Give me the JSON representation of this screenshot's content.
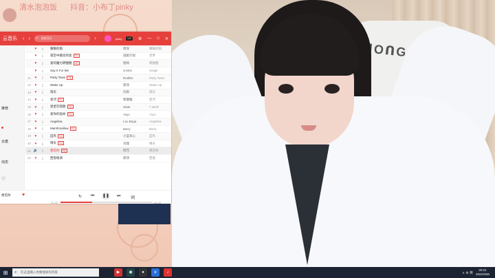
{
  "overlay": {
    "title_a": "清水泡泡饭",
    "title_b": "抖音：小布丁pinky"
  },
  "player": {
    "brand": "云音乐",
    "search_placeholder": "搜索音乐",
    "user": "pinky",
    "vip": "VIP",
    "sidebar": [
      "推荐",
      "动态",
      "云盘",
      "收藏"
    ],
    "songs": [
      {
        "idx": "",
        "title": "暖暖的抱",
        "tag": "",
        "artist": "周深",
        "album": "暖暖的抱"
      },
      {
        "idx": "",
        "title": "夜空中最亮的星",
        "tag": "SQ",
        "artist": "逃跑计划",
        "album": "世界"
      },
      {
        "idx": "",
        "title": "爱的魔力转圈圈",
        "tag": "SQ",
        "artist": "程响",
        "album": "转圈圈"
      },
      {
        "idx": "",
        "title": "Say It For Me",
        "tag": "",
        "artist": "S.Mon",
        "album": "Single"
      },
      {
        "idx": "11",
        "title": "Party Town",
        "tag": "SQ",
        "artist": "RedMo",
        "album": "Party Town"
      },
      {
        "idx": "12",
        "title": "Wake Up",
        "tag": "",
        "artist": "郭顶",
        "album": "Wake Up"
      },
      {
        "idx": "13",
        "title": "雨天",
        "tag": "",
        "artist": "刘恩",
        "album": "雨天"
      },
      {
        "idx": "14",
        "title": "星河",
        "tag": "SQ",
        "artist": "蔡健雅",
        "album": "星河"
      },
      {
        "idx": "15",
        "title": "星星在唱歌",
        "tag": "SQ",
        "artist": "State",
        "album": "7 twelF"
      },
      {
        "idx": "16",
        "title": "爱你的宿命",
        "tag": "SQ",
        "artist": "Yoyo",
        "album": "Yoyo"
      },
      {
        "idx": "17",
        "title": "Angelina",
        "tag": "",
        "artist": "Lou Bega",
        "album": "Angelina"
      },
      {
        "idx": "18",
        "title": "Marshmallow",
        "tag": "SQ",
        "artist": "Barry",
        "album": "Barry"
      },
      {
        "idx": "19",
        "title": "囚鸟",
        "tag": "SQ",
        "artist": "小蓝背心",
        "album": "囚鸟"
      },
      {
        "idx": "20",
        "title": "晴天",
        "tag": "SQ",
        "artist": "刘瑞",
        "album": "晴天"
      },
      {
        "idx": "21",
        "title": "想见你",
        "tag": "SQ",
        "artist": "阿冗",
        "album": "想见你"
      },
      {
        "idx": "22",
        "title": "西窗格调",
        "tag": "",
        "artist": "郭顶",
        "album": "西窗"
      }
    ],
    "playing_index": 14,
    "now_playing": "想见你",
    "now_artist": "阿冗",
    "time_elapsed": "01:32",
    "time_total": "04:26",
    "progress": 0.34
  },
  "taskbar": {
    "search_placeholder": "在这里输入你要搜索的内容",
    "time": "20:21",
    "date": "2022/3/30",
    "tray": "∧ ⊕ 英"
  },
  "colors": {
    "accent": "#e6403d",
    "taskbar": "#1c2433"
  }
}
